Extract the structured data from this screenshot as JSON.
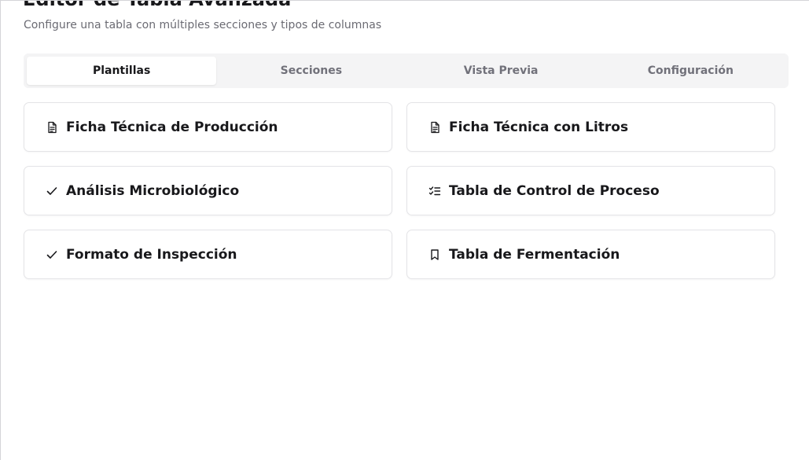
{
  "header": {
    "title": "Editor de Tabla Avanzada",
    "subtitle": "Configure una tabla con múltiples secciones y tipos de columnas"
  },
  "tabs": [
    {
      "label": "Plantillas",
      "active": true
    },
    {
      "label": "Secciones",
      "active": false
    },
    {
      "label": "Vista Previa",
      "active": false
    },
    {
      "label": "Configuración",
      "active": false
    }
  ],
  "templates": [
    {
      "label": "Ficha Técnica de Producción",
      "icon": "document-icon"
    },
    {
      "label": "Ficha Técnica con Litros",
      "icon": "document-icon"
    },
    {
      "label": "Análisis Microbiológico",
      "icon": "check-icon"
    },
    {
      "label": "Tabla de Control de Proceso",
      "icon": "checklist-icon"
    },
    {
      "label": "Formato de Inspección",
      "icon": "check-icon"
    },
    {
      "label": "Tabla de Fermentación",
      "icon": "bookmark-icon"
    }
  ]
}
